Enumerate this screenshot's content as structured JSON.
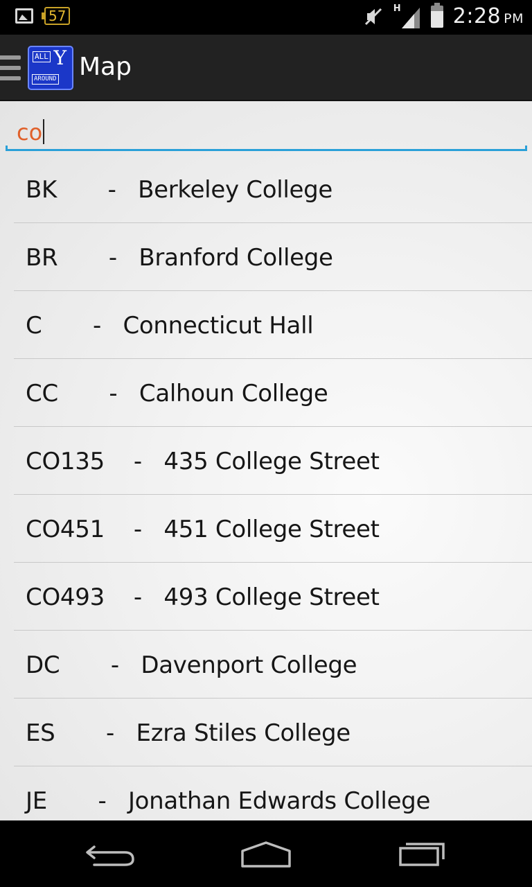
{
  "status_bar": {
    "notification_count": "57",
    "network_type": "H",
    "time": "2:28",
    "ampm": "PM"
  },
  "action_bar": {
    "title": "Map",
    "logo_top": "ALL",
    "logo_letter": "Y",
    "logo_bottom": "AROUND"
  },
  "search": {
    "query": "co"
  },
  "results": [
    {
      "code": "BK",
      "name": "Berkeley College",
      "display": "BK       -   Berkeley College"
    },
    {
      "code": "BR",
      "name": "Branford College",
      "display": "BR       -   Branford College"
    },
    {
      "code": "C",
      "name": "Connecticut Hall",
      "display": "C       -   Connecticut Hall"
    },
    {
      "code": "CC",
      "name": "Calhoun College",
      "display": "CC       -   Calhoun College"
    },
    {
      "code": "CO135",
      "name": "435 College Street",
      "display": "CO135    -   435 College Street"
    },
    {
      "code": "CO451",
      "name": "451 College Street",
      "display": "CO451    -   451 College Street"
    },
    {
      "code": "CO493",
      "name": "493 College Street",
      "display": "CO493    -   493 College Street"
    },
    {
      "code": "DC",
      "name": "Davenport College",
      "display": "DC       -   Davenport College"
    },
    {
      "code": "ES",
      "name": "Ezra Stiles College",
      "display": "ES       -   Ezra Stiles College"
    },
    {
      "code": "JE",
      "name": "Jonathan Edwards College",
      "display": "JE       -   Jonathan Edwards College"
    }
  ],
  "colors": {
    "accent": "#2aa0d8",
    "search_text": "#e0602a",
    "action_bar": "#222222"
  },
  "icons": [
    "gallery-icon",
    "notification-badge-icon",
    "mute-icon",
    "signal-icon",
    "battery-icon",
    "drawer-menu-icon",
    "back-icon",
    "home-icon",
    "recent-apps-icon"
  ]
}
